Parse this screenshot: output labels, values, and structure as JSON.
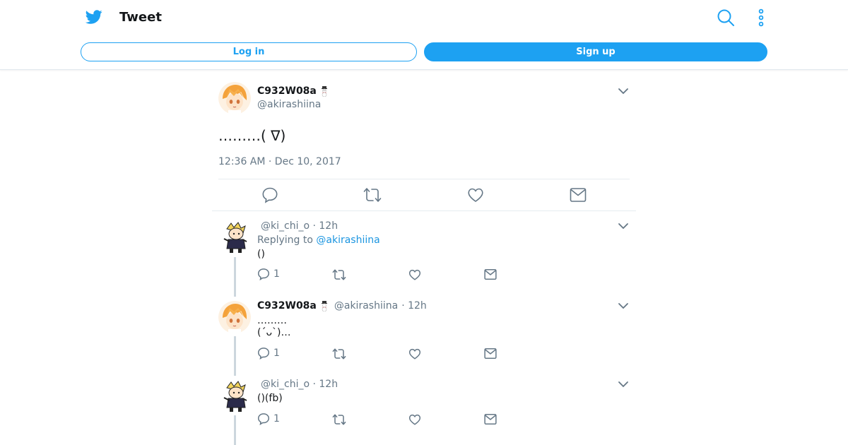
{
  "colors": {
    "brand": "#1da1f2",
    "text": "#14171a",
    "muted": "#657786",
    "link": "#1b95e0"
  },
  "header": {
    "title": "Tweet",
    "login_label": "Log in",
    "signup_label": "Sign up",
    "icons": [
      "twitter-bird-icon",
      "search-icon",
      "more-vertical-icon"
    ]
  },
  "main_tweet": {
    "name": "C932W08a",
    "handle": "@akirashiina",
    "text": "………( ∇)",
    "timestamp": "12:36 AM · Dec 10, 2017",
    "actions": [
      "reply-icon",
      "retweet-icon",
      "like-icon",
      "message-icon"
    ]
  },
  "replies": [
    {
      "handle": "@ki_chi_o",
      "time": "· 12h",
      "replying_prefix": "Replying to",
      "replying_to": "@akirashiina",
      "text": "()",
      "reply_count": "1"
    },
    {
      "name": "C932W08a",
      "handle": "@akirashiina",
      "time": "· 12h",
      "line1": "………",
      "line2": "(´ᴗ`)…",
      "reply_count": "1"
    },
    {
      "handle": "@ki_chi_o",
      "time": "· 12h",
      "text": "()(fb)",
      "reply_count": "1"
    }
  ]
}
